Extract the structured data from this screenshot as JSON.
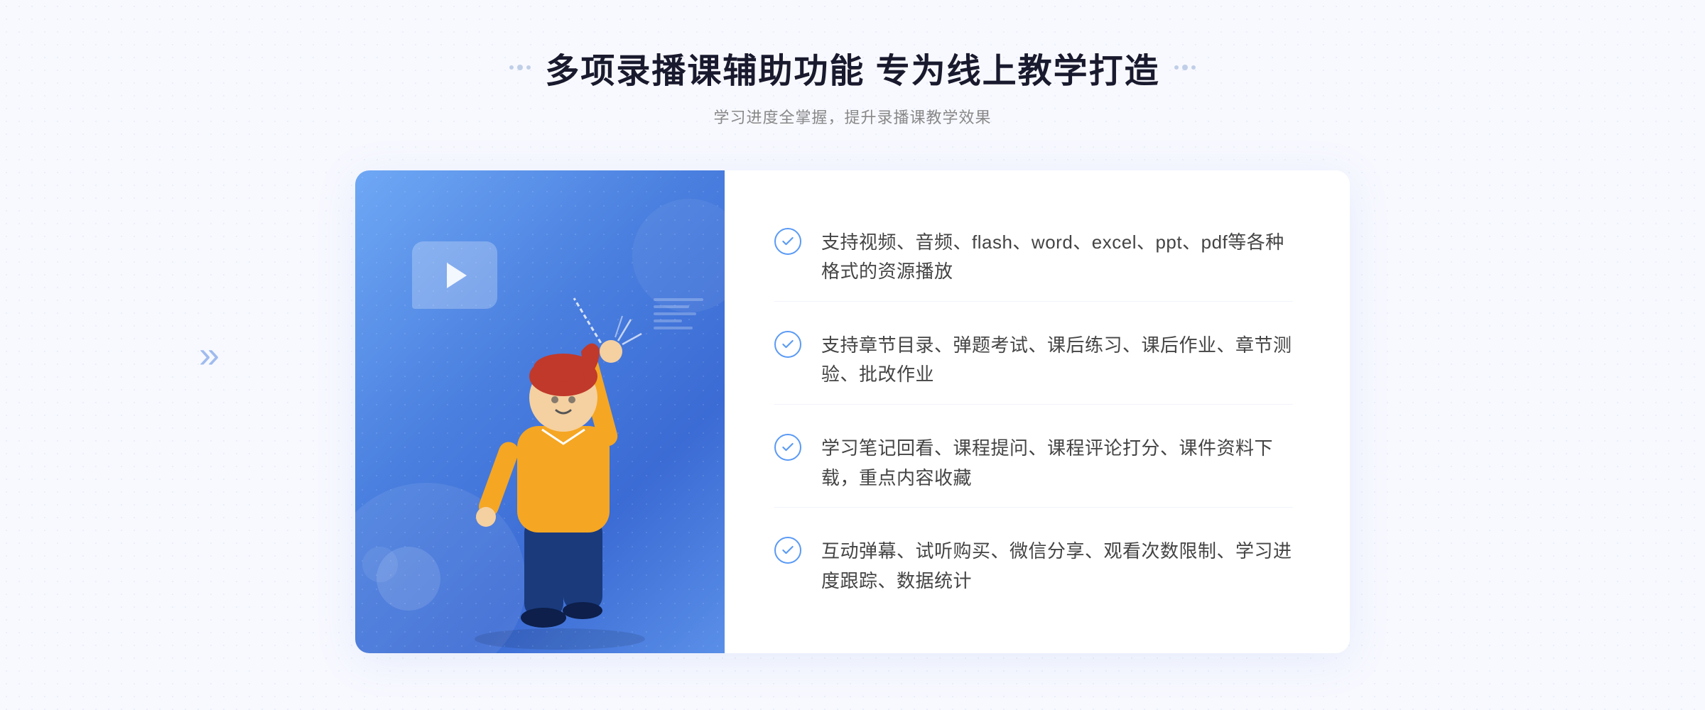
{
  "header": {
    "title": "多项录播课辅助功能 专为线上教学打造",
    "subtitle": "学习进度全掌握，提升录播课教学效果"
  },
  "decorations": {
    "left_arrow": "«",
    "right_dots_label": "decoration-dots"
  },
  "features": [
    {
      "id": "feature-1",
      "text": "支持视频、音频、flash、word、excel、ppt、pdf等各种格式的资源播放"
    },
    {
      "id": "feature-2",
      "text": "支持章节目录、弹题考试、课后练习、课后作业、章节测验、批改作业"
    },
    {
      "id": "feature-3",
      "text": "学习笔记回看、课程提问、课程评论打分、课件资料下载，重点内容收藏"
    },
    {
      "id": "feature-4",
      "text": "互动弹幕、试听购买、微信分享、观看次数限制、学习进度跟踪、数据统计"
    }
  ]
}
